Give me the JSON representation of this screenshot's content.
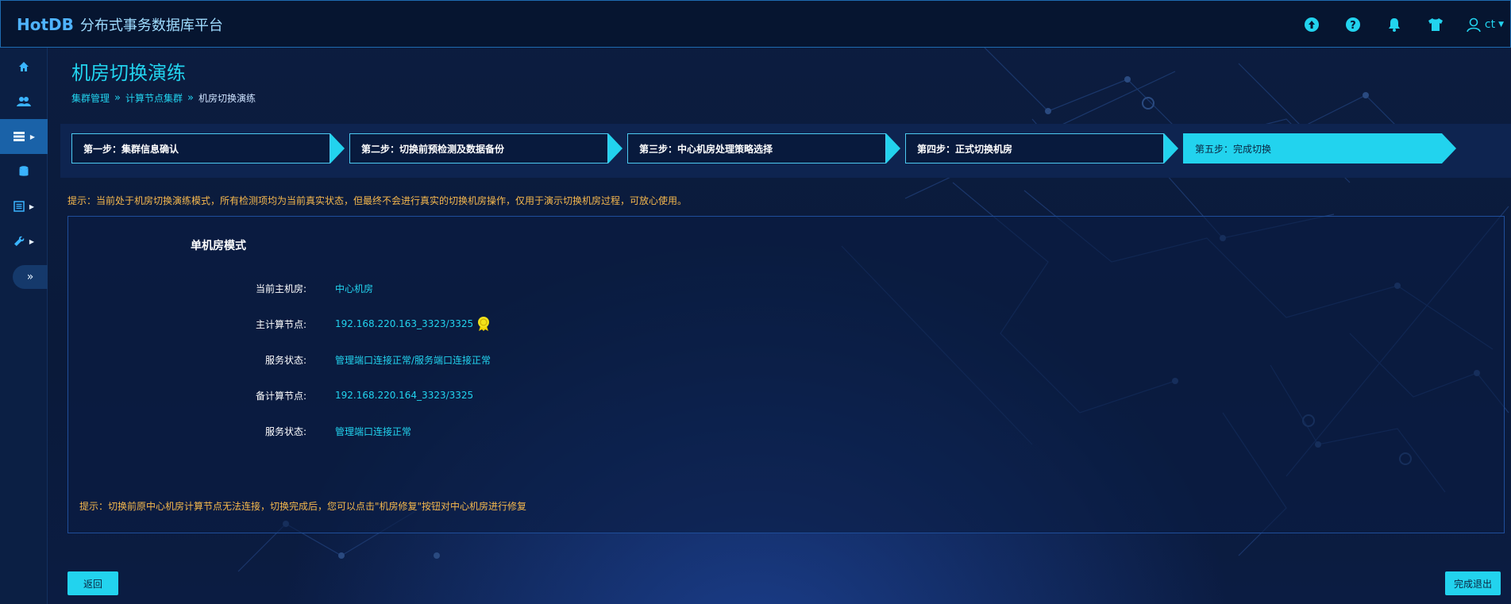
{
  "header": {
    "logo_text": "HotDB",
    "app_title": "分布式事务数据库平台",
    "user_name": "ct",
    "icons": [
      "upload-icon",
      "help-icon",
      "bell-icon",
      "theme-icon",
      "user-icon"
    ]
  },
  "sidebar": {
    "items": [
      {
        "icon": "home-icon",
        "active": false
      },
      {
        "icon": "users-icon",
        "active": false
      },
      {
        "icon": "server-icon",
        "active": true,
        "has_arrow": true
      },
      {
        "icon": "database-icon",
        "active": false
      },
      {
        "icon": "list-icon",
        "active": false,
        "has_arrow": true
      },
      {
        "icon": "wrench-icon",
        "active": false,
        "has_arrow": true
      }
    ],
    "toggle_icon": "double-chevron-right-icon"
  },
  "page": {
    "title": "机房切换演练",
    "breadcrumb": [
      "集群管理",
      "计算节点集群",
      "机房切换演练"
    ]
  },
  "steps": [
    {
      "label": "第一步：集群信息确认",
      "done": false
    },
    {
      "label": "第二步：切换前预检测及数据备份",
      "done": false
    },
    {
      "label": "第三步：中心机房处理策略选择",
      "done": false
    },
    {
      "label": "第四步：正式切换机房",
      "done": false
    },
    {
      "label": "第五步：完成切换",
      "done": true
    }
  ],
  "top_hint": "提示：当前处于机房切换演练模式，所有检测项均为当前真实状态，但最终不会进行真实的切换机房操作，仅用于演示切换机房过程，可放心使用。",
  "panel": {
    "title": "单机房模式",
    "rows": [
      {
        "label": "当前主机房:",
        "value": "中心机房"
      },
      {
        "label": "主计算节点:",
        "value": "192.168.220.163_3323/3325",
        "badge": "master-medal-icon"
      },
      {
        "label": "服务状态:",
        "value": "管理端口连接正常/服务端口连接正常"
      },
      {
        "label": "备计算节点:",
        "value": "192.168.220.164_3323/3325"
      },
      {
        "label": "服务状态:",
        "value": "管理端口连接正常"
      }
    ],
    "bottom_hint": "提示：切换前原中心机房计算节点无法连接，切换完成后，您可以点击\"机房修复\"按钮对中心机房进行修复"
  },
  "buttons": {
    "back": "返回",
    "finish": "完成退出"
  },
  "colors": {
    "accent": "#22d3ee",
    "warning": "#f6b84d",
    "sidebar_active": "#1a62a8"
  }
}
